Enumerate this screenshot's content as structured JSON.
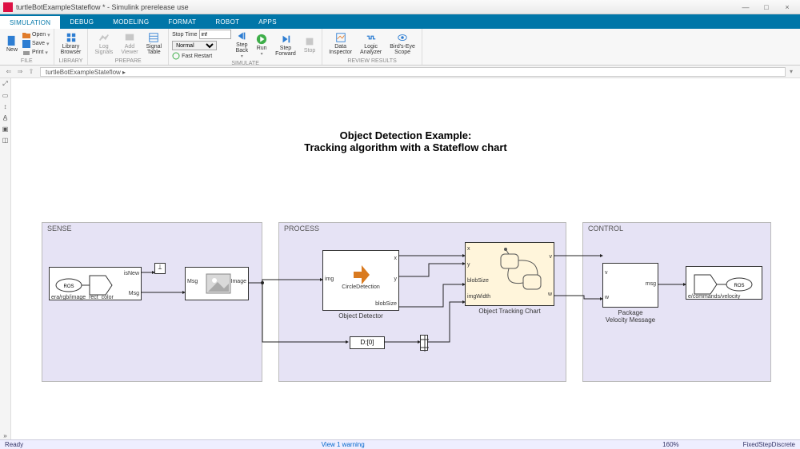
{
  "window": {
    "title": "turtleBotExampleStateflow * - Simulink prerelease use",
    "min": "—",
    "max": "□",
    "close": "×"
  },
  "tabs": [
    "SIMULATION",
    "DEBUG",
    "MODELING",
    "FORMAT",
    "ROBOT",
    "APPS"
  ],
  "ribbon": {
    "file": {
      "label": "FILE",
      "new": "New",
      "open": "Open",
      "save": "Save",
      "print": "Print"
    },
    "library": {
      "label": "LIBRARY",
      "browser": "Library\nBrowser"
    },
    "prepare": {
      "label": "PREPARE",
      "log": "Log\nSignals",
      "add": "Add\nViewer",
      "table": "Signal\nTable"
    },
    "simulate": {
      "label": "SIMULATE",
      "stoptime_label": "Stop Time",
      "stoptime": "inf",
      "solver": "Normal",
      "fastrestart": "Fast Restart",
      "stepback": "Step\nBack",
      "run": "Run",
      "stepfwd": "Step\nForward",
      "stop": "Stop"
    },
    "review": {
      "label": "REVIEW RESULTS",
      "di": "Data\nInspector",
      "la": "Logic\nAnalyzer",
      "be": "Bird's-Eye\nScope"
    }
  },
  "breadcrumb": "turtleBotExampleStateflow  ▸",
  "diagram": {
    "title": "Object Detection Example:",
    "subtitle": "Tracking algorithm with a Stateflow chart",
    "panels": {
      "sense": {
        "title": "SENSE"
      },
      "process": {
        "title": "PROCESS"
      },
      "control": {
        "title": "CONTROL"
      }
    },
    "blocks": {
      "ros_sub": {
        "topic": "era/rgb/image_rect_color",
        "new": "isNew",
        "msg": "Msg",
        "ros": "ROS"
      },
      "img_read": {
        "in": "Msg",
        "out": "Image"
      },
      "detector": {
        "name": "Object Detector",
        "fn": "CircleDetection",
        "in": "img",
        "out_x": "x",
        "out_y": "y",
        "out_bs": "blobSize"
      },
      "width_src": {
        "text": "D:[0]"
      },
      "chart": {
        "name": "Object Tracking Chart",
        "in_x": "x",
        "in_y": "y",
        "in_bs": "blobSize",
        "in_w": "imgWidth",
        "out_v": "v",
        "out_w": "w"
      },
      "pack": {
        "name": "Package\nVelocity Message",
        "in_v": "v",
        "in_w": "w",
        "out": "msg"
      },
      "ros_pub": {
        "topic": "e/commands/velocity",
        "ros": "ROS"
      }
    }
  },
  "status": {
    "ready": "Ready",
    "warning": "View 1 warning",
    "zoom": "160%",
    "solver": "FixedStepDiscrete"
  }
}
